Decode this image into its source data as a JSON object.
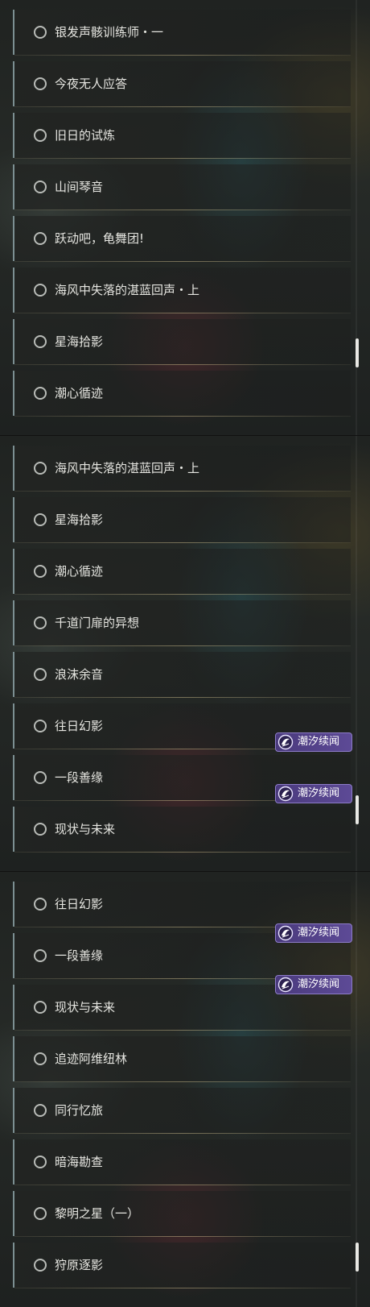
{
  "panels": [
    {
      "items": [
        {
          "title": "银发声骸训练师・一"
        },
        {
          "title": "今夜无人应答"
        },
        {
          "title": "旧日的试炼"
        },
        {
          "title": "山间琴音"
        },
        {
          "title": "跃动吧，龟舞团!"
        },
        {
          "title": "海风中失落的湛蓝回声・上"
        },
        {
          "title": "星海拾影"
        },
        {
          "title": "潮心循迹"
        }
      ]
    },
    {
      "items": [
        {
          "title": "海风中失落的湛蓝回声・上"
        },
        {
          "title": "星海拾影"
        },
        {
          "title": "潮心循迹"
        },
        {
          "title": "千道门扉的异想"
        },
        {
          "title": "浪沫余音"
        },
        {
          "title": "往日幻影"
        },
        {
          "title": "一段善缘",
          "badge": "潮汐续闻"
        },
        {
          "title": "现状与未来",
          "badge": "潮汐续闻"
        }
      ]
    },
    {
      "items": [
        {
          "title": "往日幻影"
        },
        {
          "title": "一段善缘",
          "badge": "潮汐续闻"
        },
        {
          "title": "现状与未来",
          "badge": "潮汐续闻"
        },
        {
          "title": "追迹阿维纽林"
        },
        {
          "title": "同行忆旅"
        },
        {
          "title": "暗海勘查"
        },
        {
          "title": "黎明之星（一）"
        },
        {
          "title": "狩原逐影"
        }
      ]
    }
  ],
  "icons": {
    "item_status": "circle-outline-icon",
    "badge": "tide-emblem-icon"
  },
  "colors": {
    "badge_bg": "#5d4a96",
    "item_border": "#7c8f92",
    "text": "#e6e6e1"
  }
}
